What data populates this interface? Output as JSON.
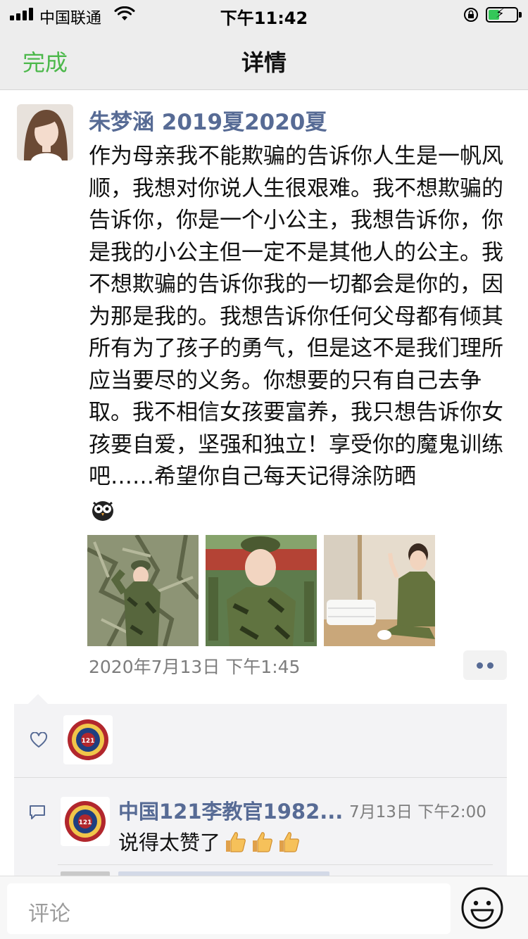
{
  "status_bar": {
    "carrier": "中国联通",
    "time": "下午11:42"
  },
  "nav": {
    "done_label": "完成",
    "title": "详情"
  },
  "post": {
    "author": "朱梦涵 2019夏2020夏",
    "text": "作为母亲我不能欺骗的告诉你人生是一帆风顺，我想对你说人生很艰难。我不想欺骗的告诉你，你是一个小公主，我想告诉你，你是我的小公主但一定不是其他人的公主。我不想欺骗的告诉你我的一切都会是你的，因为那是我的。我想告诉你任何父母都有倾其所有为了孩子的勇气，但是这不是我们理所应当要尽的义务。你想要的只有自己去争取。我不相信女孩要富养，我只想告诉你女孩要自爱，坚强和独立！享受你的魔鬼训练吧……希望你自己每天记得涂防晒",
    "time": "2020年7月13日 下午1:45",
    "photos": [
      "girl-saluting-camo-net",
      "girl-camo-uniform-parade",
      "girl-peace-sign-dorm-bed"
    ]
  },
  "interactions": {
    "likes": [
      {
        "avatar": "camp-121-badge"
      }
    ],
    "comments": [
      {
        "name": "中国121李教官1982...",
        "time": "7月13日 下午2:00",
        "text": "说得太赞了",
        "emoji": [
          "thumbs-up",
          "thumbs-up",
          "thumbs-up"
        ]
      }
    ]
  },
  "comment_input": {
    "placeholder": "评论"
  },
  "colors": {
    "link_blue": "#576b95",
    "done_green": "#4cb84b",
    "panel_bg": "#f3f3f5",
    "nav_bg": "#ededed"
  }
}
